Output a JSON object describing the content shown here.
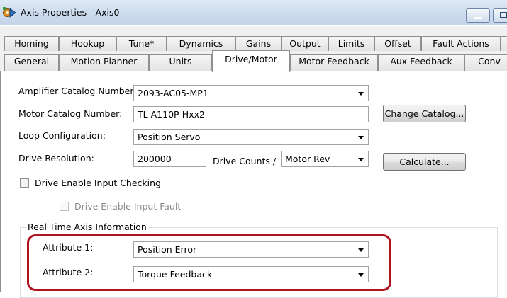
{
  "window": {
    "title": "Axis Properties - Axis0"
  },
  "tabs": {
    "row1": [
      "Homing",
      "Hookup",
      "Tune*",
      "Dynamics",
      "Gains",
      "Output",
      "Limits",
      "Offset",
      "Fault Actions"
    ],
    "row2": [
      "General",
      "Motion Planner",
      "Units",
      "Drive/Motor",
      "Motor Feedback",
      "Aux Feedback",
      "Conv"
    ],
    "selected": "Drive/Motor"
  },
  "form": {
    "amplifier_label": "Amplifier Catalog Number:",
    "amplifier_value": "2093-AC05-MP1",
    "motor_label": "Motor Catalog Number:",
    "motor_value": "TL-A110P-Hxx2",
    "change_catalog_label": "Change Catalog...",
    "loop_label": "Loop Configuration:",
    "loop_value": "Position Servo",
    "resolution_label": "Drive Resolution:",
    "resolution_value": "200000",
    "drive_counts_label": "Drive Counts /",
    "units_value": "Motor Rev",
    "calculate_label": "Calculate...",
    "enable_checking_label": "Drive Enable Input Checking",
    "enable_checking_checked": false,
    "enable_fault_label": "Drive Enable Input Fault",
    "enable_fault_checked": false
  },
  "realtime": {
    "group_title": "Real Time Axis Information",
    "attr1_label": "Attribute 1:",
    "attr1_value": "Position Error",
    "attr2_label": "Attribute 2:",
    "attr2_value": "Torque Feedback",
    "highlight_color": "#b0141e"
  },
  "colors": {
    "titlebar": "#cddbee",
    "tabstrip": "#f0f0f0",
    "disabled_text": "#8a8a8a"
  }
}
